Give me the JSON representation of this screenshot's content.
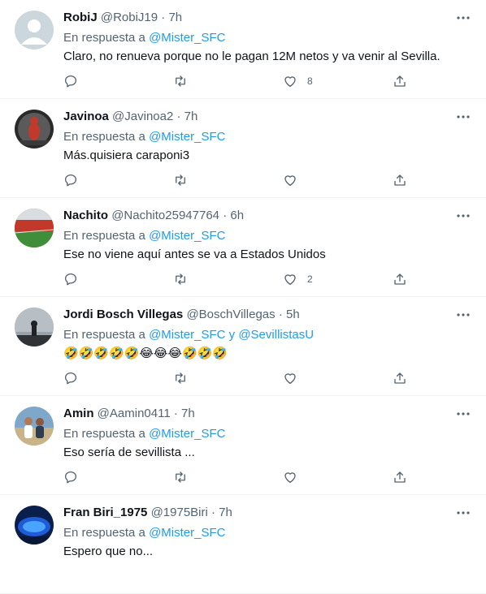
{
  "reply_prefix": "En respuesta a",
  "colors": {
    "accent": "#1d9bf0",
    "secondary": "#536471",
    "text": "#0f1419",
    "divider": "#eff3f4"
  },
  "tweets": [
    {
      "name": "RobiJ",
      "handle": "@RobiJ19",
      "time": "7h",
      "reply_to_1": "@Mister_SFC",
      "conjunction": "",
      "reply_to_2": "",
      "text": "Claro, no renueva porque no le pagan 12M netos y va venir al Sevilla.",
      "likes": "8",
      "avatar": "default-profile"
    },
    {
      "name": "Javinoa",
      "handle": "@Javinoa2",
      "time": "7h",
      "reply_to_1": "@Mister_SFC",
      "conjunction": "",
      "reply_to_2": "",
      "text": "Más.quisiera caraponi3",
      "likes": "",
      "avatar": "red-figure"
    },
    {
      "name": "Nachito",
      "handle": "@Nachito25947764",
      "time": "6h",
      "reply_to_1": "@Mister_SFC",
      "conjunction": "",
      "reply_to_2": "",
      "text": "Ese no viene aquí antes se va a Estados Unidos",
      "likes": "2",
      "avatar": "stadium"
    },
    {
      "name": "Jordi Bosch Villegas",
      "handle": "@BoschVillegas",
      "time": "5h",
      "reply_to_1": "@Mister_SFC",
      "conjunction": "y",
      "reply_to_2": "@SevillistasU",
      "text": "🤣🤣🤣🤣🤣😂😂😂🤣🤣🤣",
      "likes": "",
      "avatar": "silhouette"
    },
    {
      "name": "Amin",
      "handle": "@Aamin0411",
      "time": "7h",
      "reply_to_1": "@Mister_SFC",
      "conjunction": "",
      "reply_to_2": "",
      "text": "Eso sería de sevillista ...",
      "likes": "",
      "avatar": "couple-photo"
    },
    {
      "name": "Fran Biri_1975",
      "handle": "@1975Biri",
      "time": "7h",
      "reply_to_1": "@Mister_SFC",
      "conjunction": "",
      "reply_to_2": "",
      "text": "Espero que no...",
      "likes": "",
      "avatar": "blue-stadium"
    }
  ]
}
